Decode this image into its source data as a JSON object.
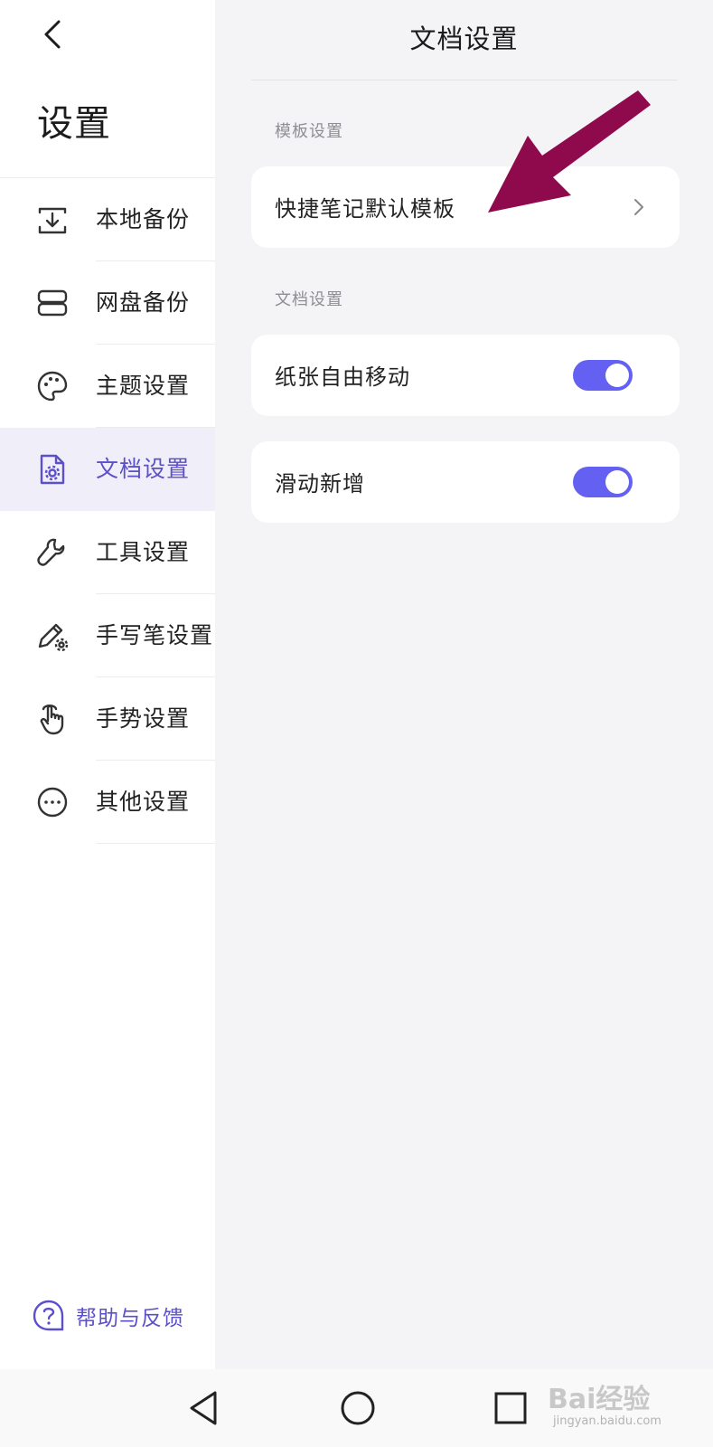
{
  "sidebar": {
    "title": "设置",
    "items": [
      {
        "label": "本地备份",
        "icon": "local-backup-icon"
      },
      {
        "label": "网盘备份",
        "icon": "cloud-backup-icon"
      },
      {
        "label": "主题设置",
        "icon": "palette-icon"
      },
      {
        "label": "文档设置",
        "icon": "document-settings-icon",
        "active": true
      },
      {
        "label": "工具设置",
        "icon": "wrench-icon"
      },
      {
        "label": "手写笔设置",
        "icon": "pen-settings-icon"
      },
      {
        "label": "手势设置",
        "icon": "gesture-icon"
      },
      {
        "label": "其他设置",
        "icon": "more-icon"
      }
    ],
    "help_label": "帮助与反馈"
  },
  "main": {
    "title": "文档设置",
    "template_section_label": "模板设置",
    "template_item_label": "快捷笔记默认模板",
    "document_section_label": "文档设置",
    "toggles": [
      {
        "label": "纸张自由移动",
        "on": true
      },
      {
        "label": "滑动新增",
        "on": true
      }
    ]
  },
  "watermark": {
    "text": "Bai经验",
    "sub": "jingyan.baidu.com"
  },
  "colors": {
    "accent": "#5b50c9",
    "toggle": "#6360f2",
    "arrow": "#8e0a4c",
    "panel_bg": "#f4f4f6"
  }
}
